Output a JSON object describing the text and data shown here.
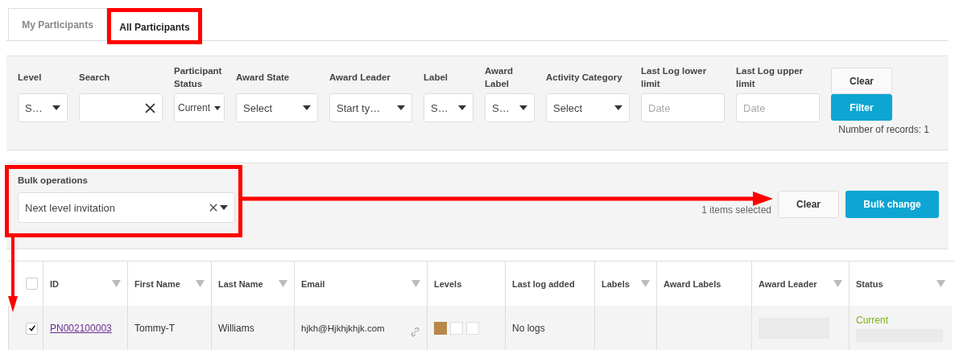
{
  "tabs": [
    {
      "label": "My Participants",
      "selected": false
    },
    {
      "label": "All Participants",
      "selected": true
    }
  ],
  "filters": [
    {
      "label": "Level",
      "kind": "select",
      "value": "S…"
    },
    {
      "label": "Search",
      "kind": "search"
    },
    {
      "label": "Participant Status",
      "kind": "multiselect",
      "value": "Current"
    },
    {
      "label": "Award State",
      "kind": "select",
      "value": "Select"
    },
    {
      "label": "Award Leader",
      "kind": "select",
      "value": "Start ty…"
    },
    {
      "label": "Label",
      "kind": "select",
      "value": "S…"
    },
    {
      "label": "Award Label",
      "kind": "select",
      "value": "S…"
    },
    {
      "label": "Activity Category",
      "kind": "select",
      "value": "Select"
    },
    {
      "label": "Last Log lower limit",
      "kind": "date",
      "placeholder": "Date"
    },
    {
      "label": "Last Log upper limit",
      "kind": "date",
      "placeholder": "Date"
    }
  ],
  "filter_buttons": {
    "clear": "Clear",
    "filter": "Filter"
  },
  "record_count": "Number of records: 1",
  "bulk": {
    "label": "Bulk operations",
    "value": "Next level invitation",
    "selected_count": "1 items selected",
    "clear": "Clear",
    "apply": "Bulk change"
  },
  "table": {
    "select_all_checked": false,
    "columns": [
      {
        "label": "ID",
        "filterable": true
      },
      {
        "label": "First Name",
        "filterable": true
      },
      {
        "label": "Last Name",
        "filterable": true
      },
      {
        "label": "Email",
        "filterable": true
      },
      {
        "label": "Levels",
        "filterable": false
      },
      {
        "label": "Last log added",
        "filterable": false
      },
      {
        "label": "Labels",
        "filterable": true
      },
      {
        "label": "Award Labels",
        "filterable": false
      },
      {
        "label": "Award Leader",
        "filterable": true
      },
      {
        "label": "Status",
        "filterable": true
      }
    ],
    "rows": [
      {
        "checked": true,
        "id": "PN002100003",
        "first_name": "Tommy-T",
        "last_name": "Williams",
        "email": "hjkh@Hjkhjkhjk.com",
        "levels": [
          {
            "filled": true
          },
          {
            "filled": false
          },
          {
            "filled": false
          }
        ],
        "last_log": "No logs",
        "status": "Current"
      }
    ]
  }
}
